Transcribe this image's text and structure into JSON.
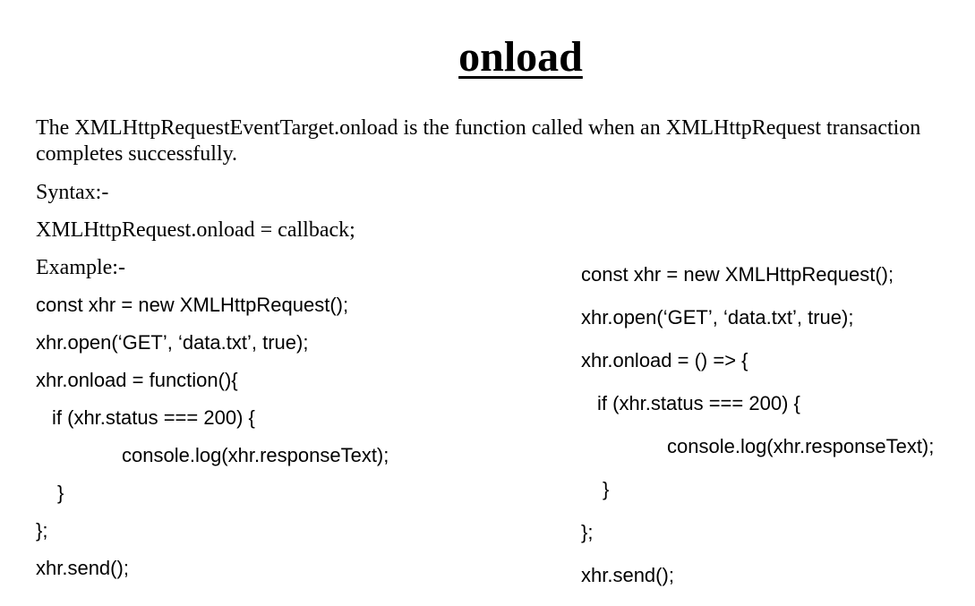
{
  "title": "onload",
  "description": "The XMLHttpRequestEventTarget.onload is the function called when an XMLHttpRequest transaction completes successfully.",
  "syntax": {
    "label": "Syntax:-",
    "line": "XMLHttpRequest.onload = callback;"
  },
  "example": {
    "label": "Example:-",
    "left_code": [
      "const xhr = new XMLHttpRequest();",
      "xhr.open(‘GET’, ‘data.txt’, true);",
      "xhr.onload = function(){",
      "if (xhr.status === 200) {",
      "console.log(xhr.responseText);",
      "}",
      "};",
      "xhr.send();"
    ],
    "right_code": [
      "const xhr = new XMLHttpRequest();",
      "xhr.open(‘GET’, ‘data.txt’, true);",
      "xhr.onload = () => {",
      "if (xhr.status === 200) {",
      "console.log(xhr.responseText);",
      "}",
      "};",
      "xhr.send();"
    ]
  }
}
